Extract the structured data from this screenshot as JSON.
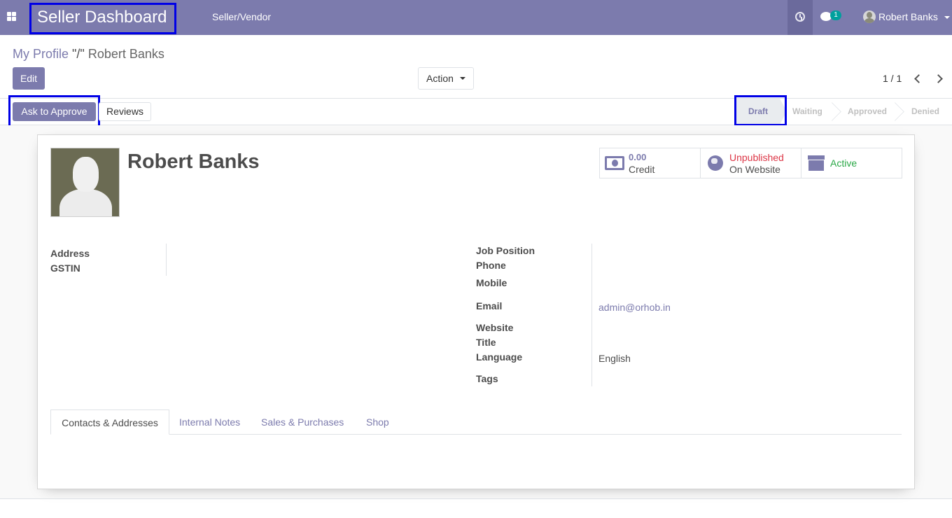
{
  "navbar": {
    "brand": "Seller Dashboard",
    "menu_item": "Seller/Vendor",
    "chat_count": "1",
    "user_name": "Robert Banks",
    "icons": [
      "apps-icon",
      "clock-icon",
      "chat-icon",
      "avatar",
      "caret-down-icon"
    ]
  },
  "breadcrumb": {
    "parent": "My Profile",
    "separator": "\"/\"",
    "current": "Robert Banks"
  },
  "control": {
    "edit_label": "Edit",
    "action_label": "Action",
    "pager": "1 / 1"
  },
  "statusbar": {
    "ask_label": "Ask to Approve",
    "reviews_label": "Reviews",
    "stages": [
      "Draft",
      "Waiting",
      "Approved",
      "Denied"
    ],
    "current_stage": "Draft"
  },
  "record": {
    "name": "Robert Banks",
    "stats": {
      "credit_value": "0.00",
      "credit_label": "Credit",
      "website_status": "Unpublished",
      "website_label": "On Website",
      "active_label": "Active"
    },
    "left_fields": {
      "address_label": "Address",
      "gstin_label": "GSTIN"
    },
    "right_fields": {
      "job_position_label": "Job Position",
      "phone_label": "Phone",
      "mobile_label": "Mobile",
      "email_label": "Email",
      "email_value": "admin@orhob.in",
      "website_label": "Website",
      "title_label": "Title",
      "language_label": "Language",
      "language_value": "English",
      "tags_label": "Tags"
    }
  },
  "tabs": [
    "Contacts & Addresses",
    "Internal Notes",
    "Sales & Purchases",
    "Shop"
  ],
  "colors": {
    "brand": "#7c7bad",
    "highlight_box": "#0000e6",
    "unpublished": "#dc3545",
    "active": "#28a745"
  }
}
